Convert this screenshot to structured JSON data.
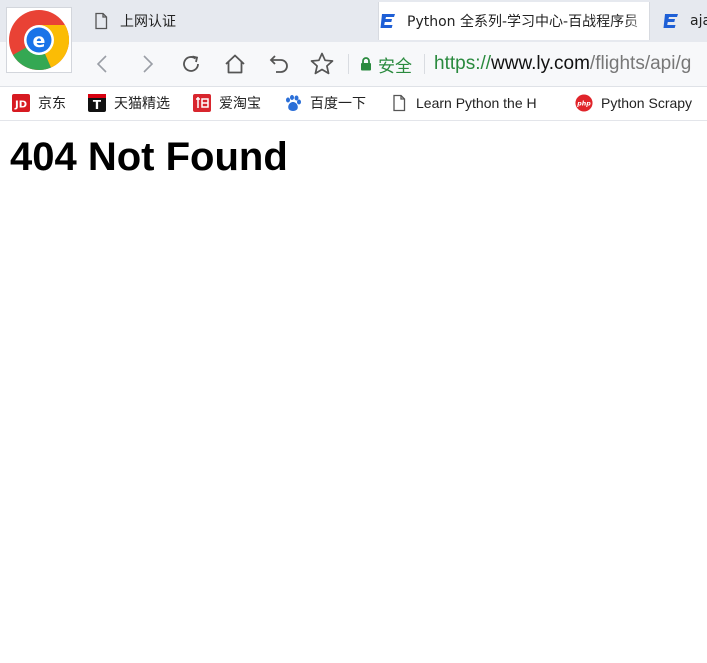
{
  "tabs": [
    {
      "title": "上网认证",
      "icon": "document-icon"
    },
    {
      "title": "Python 全系列-学习中心-百战程序员",
      "icon": "site-logo-icon"
    },
    {
      "title": "aja",
      "icon": "site-logo-icon"
    }
  ],
  "toolbar": {
    "secure_label": "安全",
    "url_scheme": "https://",
    "url_host": "www.ly.com",
    "url_path": "/flights/api/g"
  },
  "bookmarks": [
    {
      "label": "京东",
      "icon": "jd-icon"
    },
    {
      "label": "天猫精选",
      "icon": "tmall-icon"
    },
    {
      "label": "爱淘宝",
      "icon": "taobao-icon"
    },
    {
      "label": "百度一下",
      "icon": "baidu-paw-icon"
    },
    {
      "label": "Learn Python the H",
      "icon": "document-icon"
    },
    {
      "label": "Python Scrapy",
      "icon": "php-icon"
    }
  ],
  "page": {
    "heading": "404 Not Found"
  },
  "colors": {
    "secure_green": "#2a8a3e",
    "tabstrip_bg": "#e6e9ef",
    "site_logo_blue": "#1e5fd6"
  }
}
